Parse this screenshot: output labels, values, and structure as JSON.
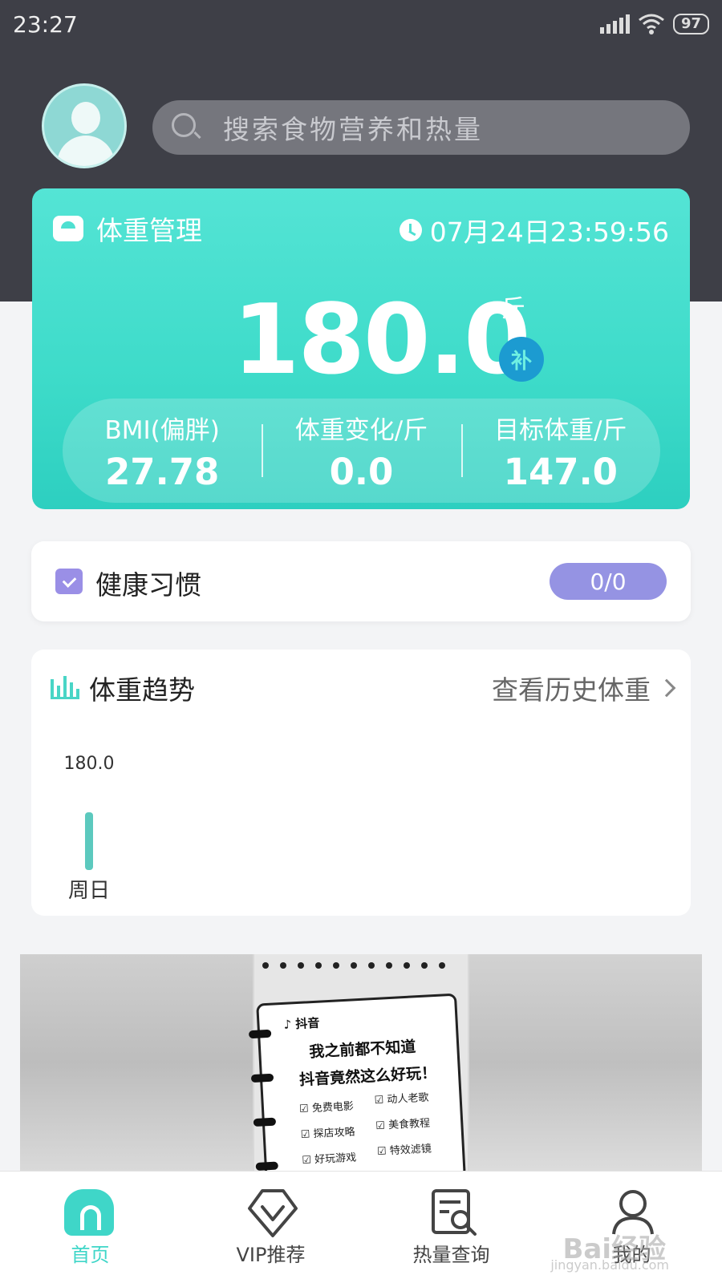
{
  "status_bar": {
    "time": "23:27",
    "battery": "97"
  },
  "search": {
    "placeholder": "搜索食物营养和热量"
  },
  "weight_card": {
    "title": "体重管理",
    "datetime": "07月24日23:59:56",
    "weight": "180.0",
    "unit": "斤",
    "supplement_badge": "补",
    "stats": [
      {
        "label": "BMI(偏胖)",
        "value": "27.78"
      },
      {
        "label": "体重变化/斤",
        "value": "0.0"
      },
      {
        "label": "目标体重/斤",
        "value": "147.0"
      }
    ]
  },
  "habit_card": {
    "title": "健康习惯",
    "progress": "0/0"
  },
  "trend_card": {
    "title": "体重趋势",
    "link": "查看历史体重"
  },
  "chart_data": {
    "type": "bar",
    "categories": [
      "周日"
    ],
    "values": [
      180.0
    ],
    "data_labels": [
      "180.0"
    ],
    "color": "#5cc9be"
  },
  "banner": {
    "brand": "抖音",
    "line1": "我之前都不知道",
    "line2": "抖音竟然这么好玩！",
    "items": [
      "免费电影",
      "动人老歌",
      "探店攻略",
      "美食教程",
      "好玩游戏",
      "特效滤镜"
    ]
  },
  "bottom_nav": {
    "items": [
      {
        "label": "首页",
        "icon": "home-icon",
        "active": true
      },
      {
        "label": "VIP推荐",
        "icon": "vip-icon",
        "active": false
      },
      {
        "label": "热量查询",
        "icon": "search-document-icon",
        "active": false
      },
      {
        "label": "我的",
        "icon": "user-icon",
        "active": false
      }
    ]
  },
  "watermark": {
    "text": "Bai经验",
    "sub": "jingyan.baidu.com"
  },
  "colors": {
    "accent": "#3fd6c8",
    "header": "#3e3f47",
    "habit_badge": "#9593e3",
    "badge_blue": "#1c9bd1"
  }
}
